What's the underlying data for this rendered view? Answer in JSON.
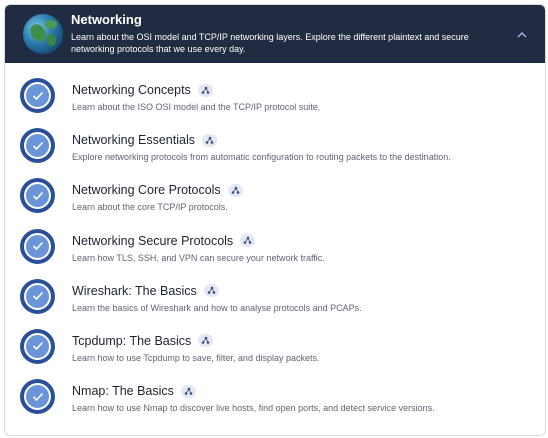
{
  "header": {
    "title": "Networking",
    "description": "Learn about the OSI model and TCP/IP networking layers. Explore the different plaintext and secure networking protocols that we use every day.",
    "icon": "globe-icon",
    "collapse_icon": "chevron-up-icon"
  },
  "rooms": [
    {
      "title": "Networking Concepts",
      "description": "Learn about the ISO OSI model and the TCP/IP protocol suite.",
      "completed": true
    },
    {
      "title": "Networking Essentials",
      "description": "Explore networking protocols from automatic configuration to routing packets to the destination.",
      "completed": true
    },
    {
      "title": "Networking Core Protocols",
      "description": "Learn about the core TCP/IP protocols.",
      "completed": true
    },
    {
      "title": "Networking Secure Protocols",
      "description": "Learn how TLS, SSH, and VPN can secure your network traffic.",
      "completed": true
    },
    {
      "title": "Wireshark: The Basics",
      "description": "Learn the basics of Wireshark and how to analyse protocols and PCAPs.",
      "completed": true
    },
    {
      "title": "Tcpdump: The Basics",
      "description": "Learn how to use Tcpdump to save, filter, and display packets.",
      "completed": true
    },
    {
      "title": "Nmap: The Basics",
      "description": "Learn how to use Nmap to discover live hosts, find open ports, and detect service versions.",
      "completed": true
    }
  ],
  "colors": {
    "header_bg": "#212c42",
    "check_ring": "#2a4f9a",
    "check_fill": "#6a95d8",
    "badge_bg": "#e3e8f2"
  }
}
